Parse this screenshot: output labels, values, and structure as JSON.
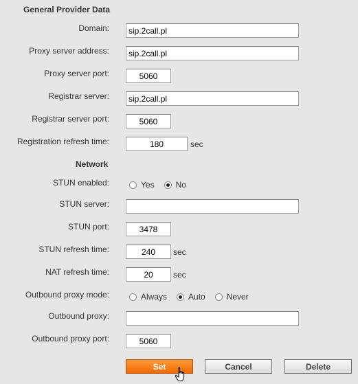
{
  "general": {
    "title": "General Provider Data",
    "domain_label": "Domain:",
    "domain_value": "sip.2call.pl",
    "proxy_address_label": "Proxy server address:",
    "proxy_address_value": "sip.2call.pl",
    "proxy_port_label": "Proxy server port:",
    "proxy_port_value": "5060",
    "registrar_label": "Registrar server:",
    "registrar_value": "sip.2call.pl",
    "registrar_port_label": "Registrar server port:",
    "registrar_port_value": "5060",
    "refresh_label": "Registration refresh time:",
    "refresh_value": "180",
    "refresh_unit": "sec"
  },
  "network": {
    "title": "Network",
    "stun_enabled_label": "STUN enabled:",
    "stun_yes": "Yes",
    "stun_no": "No",
    "stun_enabled_selected": "No",
    "stun_server_label": "STUN server:",
    "stun_server_value": "",
    "stun_port_label": "STUN port:",
    "stun_port_value": "3478",
    "stun_refresh_label": "STUN refresh time:",
    "stun_refresh_value": "240",
    "stun_refresh_unit": "sec",
    "nat_refresh_label": "NAT refresh time:",
    "nat_refresh_value": "20",
    "nat_refresh_unit": "sec",
    "outbound_mode_label": "Outbound proxy mode:",
    "mode_always": "Always",
    "mode_auto": "Auto",
    "mode_never": "Never",
    "outbound_mode_selected": "Auto",
    "outbound_proxy_label": "Outbound proxy:",
    "outbound_proxy_value": "",
    "outbound_port_label": "Outbound proxy port:",
    "outbound_port_value": "5060"
  },
  "buttons": {
    "set": "Set",
    "cancel": "Cancel",
    "delete": "Delete"
  },
  "colors": {
    "background": "#e6e6e6",
    "primary_button": "#f07a10"
  },
  "icons": {
    "cursor": "hand-pointer-icon"
  }
}
